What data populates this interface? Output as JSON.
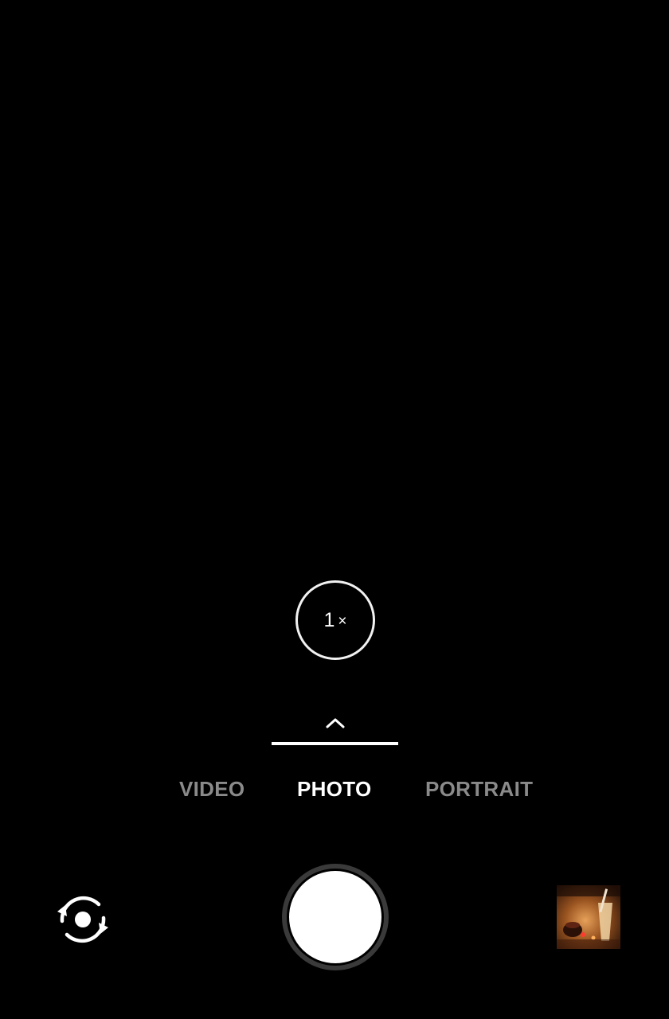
{
  "zoom": {
    "value": "1",
    "unit": "×"
  },
  "modes": {
    "items": [
      {
        "label": "VIDEO",
        "active": false
      },
      {
        "label": "PHOTO",
        "active": true
      },
      {
        "label": "PORTRAIT",
        "active": false
      }
    ]
  },
  "icons": {
    "expand": "chevron-up-icon",
    "switch_camera": "camera-switch-icon",
    "shutter": "shutter-button",
    "gallery": "gallery-thumbnail"
  },
  "colors": {
    "background": "#000000",
    "active_text": "#ffffff",
    "inactive_text": "#8a8a8a",
    "shutter": "#ffffff",
    "shutter_ring": "#3a3a3a"
  }
}
